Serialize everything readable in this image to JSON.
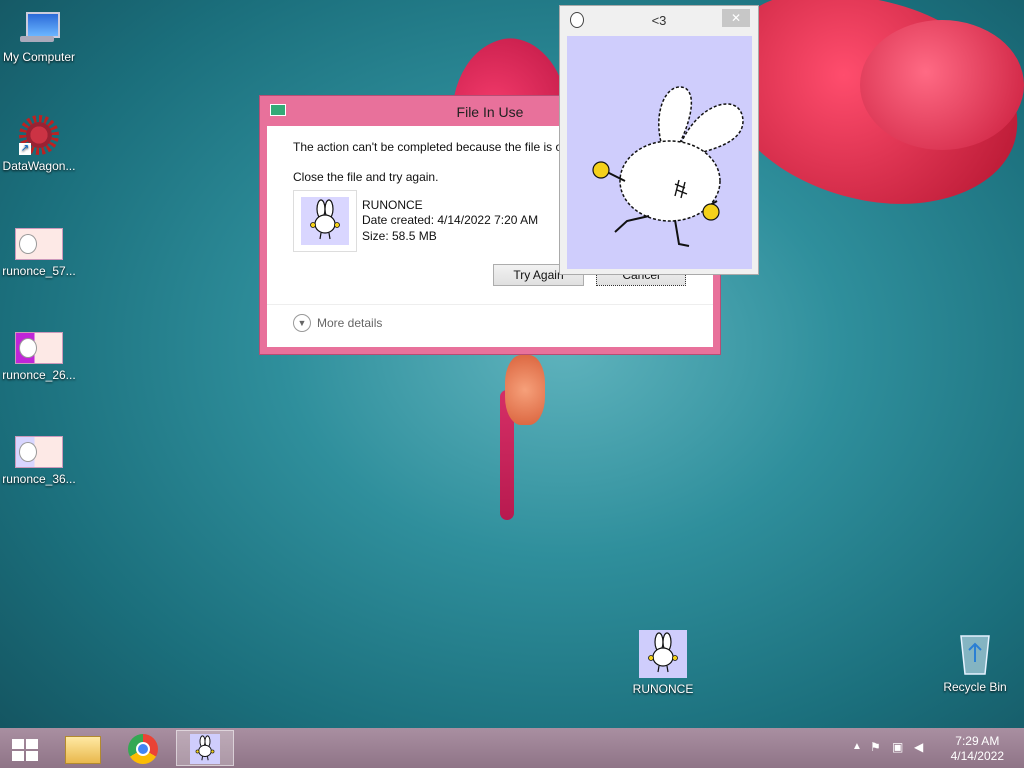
{
  "desktop": {
    "icons": [
      {
        "label": "My Computer"
      },
      {
        "label": "DataWagon..."
      },
      {
        "label": "runonce_57..."
      },
      {
        "label": "runonce_26..."
      },
      {
        "label": "runonce_36..."
      },
      {
        "label": "RUNONCE"
      },
      {
        "label": "Recycle Bin"
      }
    ]
  },
  "dialog": {
    "title": "File In Use",
    "message": "The action can't be completed because the file is o",
    "instruction": "Close the file and try again.",
    "file_name": "RUNONCE",
    "date_created": "Date created: 4/14/2022 7:20 AM",
    "size": "Size: 58.5 MB",
    "try_again": "Try Again",
    "cancel": "Cancel",
    "more_details": "More details"
  },
  "popup": {
    "title": "<3",
    "close": "✕"
  },
  "tray": {
    "time": "7:29 AM",
    "date": "4/14/2022"
  },
  "colors": {
    "dialog_frame": "#e8719b",
    "popup_canvas": "#cfcdfc",
    "taskbar": "#9e8597"
  }
}
